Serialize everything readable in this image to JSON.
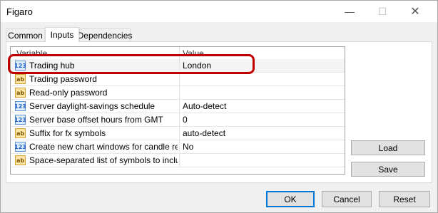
{
  "window": {
    "title": "Figaro",
    "minimize_glyph": "—",
    "maximize_glyph": "☐",
    "close_glyph": "✕"
  },
  "tabs": [
    {
      "label": "Common",
      "active": false
    },
    {
      "label": "Inputs",
      "active": true
    },
    {
      "label": "Dependencies",
      "active": false
    }
  ],
  "grid": {
    "columns": [
      "Variable",
      "Value"
    ],
    "rows": [
      {
        "icon": "numeric-icon",
        "icon_text": "123",
        "variable": "Trading hub",
        "value": "London"
      },
      {
        "icon": "text-icon",
        "icon_text": "ab",
        "variable": "Trading password",
        "value": ""
      },
      {
        "icon": "text-icon",
        "icon_text": "ab",
        "variable": "Read-only password",
        "value": ""
      },
      {
        "icon": "numeric-icon",
        "icon_text": "123",
        "variable": "Server daylight-savings schedule",
        "value": "Auto-detect"
      },
      {
        "icon": "numeric-icon",
        "icon_text": "123",
        "variable": "Server base offset hours from GMT",
        "value": "0"
      },
      {
        "icon": "text-icon",
        "icon_text": "ab",
        "variable": "Suffix for fx symbols",
        "value": "auto-detect"
      },
      {
        "icon": "numeric-icon",
        "icon_text": "123",
        "variable": "Create new chart windows for candle req...",
        "value": "No"
      },
      {
        "icon": "text-icon",
        "icon_text": "ab",
        "variable": "Space-separated list of symbols to include...",
        "value": ""
      }
    ]
  },
  "side_buttons": {
    "load": "Load",
    "save": "Save"
  },
  "footer_buttons": {
    "ok": "OK",
    "cancel": "Cancel",
    "reset": "Reset"
  },
  "colors": {
    "highlight": "#c00000",
    "accent": "#0078d7"
  }
}
